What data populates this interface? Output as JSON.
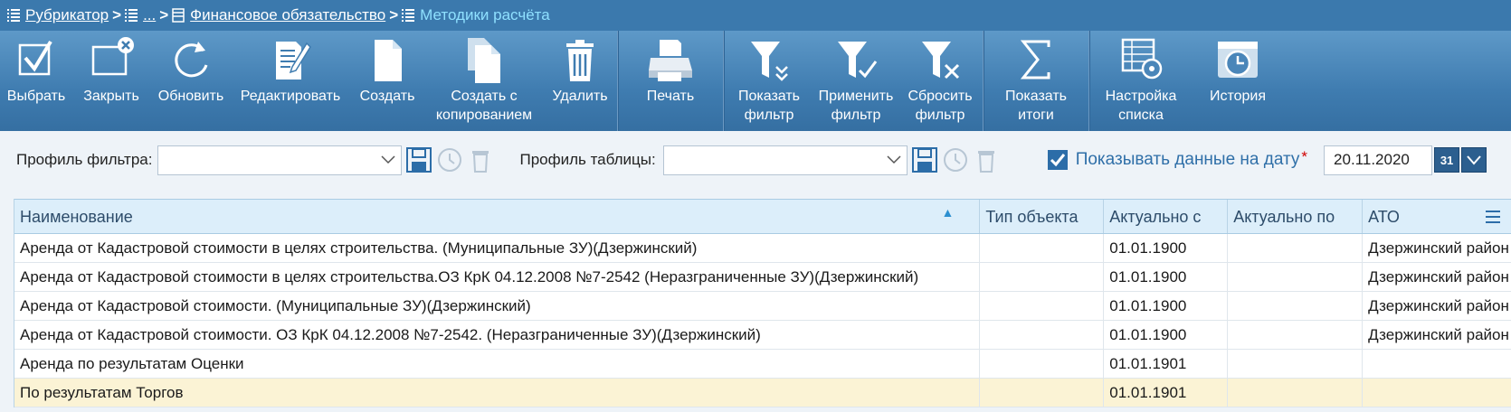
{
  "breadcrumb": {
    "items": [
      {
        "label": "Рубрикатор",
        "icon": "list-icon"
      },
      {
        "label": "...",
        "icon": "list-icon"
      },
      {
        "label": "Финансовое обязательство",
        "icon": "table-icon"
      }
    ],
    "separator": ">",
    "current": "Методики расчёта"
  },
  "toolbar": {
    "select": "Выбрать",
    "close": "Закрыть",
    "refresh": "Обновить",
    "edit": "Редактировать",
    "create": "Создать",
    "create_copy_1": "Создать с",
    "create_copy_2": "копированием",
    "delete": "Удалить",
    "print": "Печать",
    "show_filter_1": "Показать",
    "show_filter_2": "фильтр",
    "apply_filter_1": "Применить",
    "apply_filter_2": "фильтр",
    "reset_filter_1": "Сбросить",
    "reset_filter_2": "фильтр",
    "totals_1": "Показать",
    "totals_2": "итоги",
    "list_settings_1": "Настройка",
    "list_settings_2": "списка",
    "history": "История"
  },
  "filters": {
    "filter_profile_label": "Профиль фильтра:",
    "filter_profile_value": "",
    "table_profile_label": "Профиль таблицы:",
    "table_profile_value": "",
    "show_on_date_label": "Показывать данные на дату",
    "required_mark": "*",
    "show_on_date_checked": true,
    "date_value": "20.11.2020",
    "calendar_label": "31"
  },
  "table": {
    "columns": [
      "Наименование",
      "Тип объекта",
      "Актуально с",
      "Актуально по",
      "АТО"
    ],
    "sort_indicator": "▲",
    "rows": [
      {
        "name": "Аренда от Кадастровой стоимости в целях строительства. (Муниципальные ЗУ)(Дзержинский)",
        "type": "",
        "from": "01.01.1900",
        "to": "",
        "ato": "Дзержинский район"
      },
      {
        "name": "Аренда от Кадастровой стоимости в целях строительства.ОЗ КрК 04.12.2008 №7-2542 (Неразграниченные ЗУ)(Дзержинский)",
        "type": "",
        "from": "01.01.1900",
        "to": "",
        "ato": "Дзержинский район"
      },
      {
        "name": "Аренда от Кадастровой стоимости. (Муниципальные ЗУ)(Дзержинский)",
        "type": "",
        "from": "01.01.1900",
        "to": "",
        "ato": "Дзержинский район"
      },
      {
        "name": "Аренда от Кадастровой стоимости. ОЗ КрК 04.12.2008 №7-2542. (Неразграниченные ЗУ)(Дзержинский)",
        "type": "",
        "from": "01.01.1900",
        "to": "",
        "ato": "Дзержинский район"
      },
      {
        "name": "Аренда по результатам Оценки",
        "type": "",
        "from": "01.01.1901",
        "to": "",
        "ato": ""
      },
      {
        "name": "По результатам Торгов",
        "type": "",
        "from": "01.01.1901",
        "to": "",
        "ato": ""
      }
    ],
    "selected_row": 5
  },
  "colors": {
    "breadcrumb_bg": "#3b79ad",
    "toolbar_bg": "#4a86b9",
    "current_crumb": "#8fe0ff",
    "header_bg": "#dceefa",
    "selected_row_bg": "#fbf3d5",
    "required": "#d00000",
    "accent_text": "#2f6fa8"
  }
}
